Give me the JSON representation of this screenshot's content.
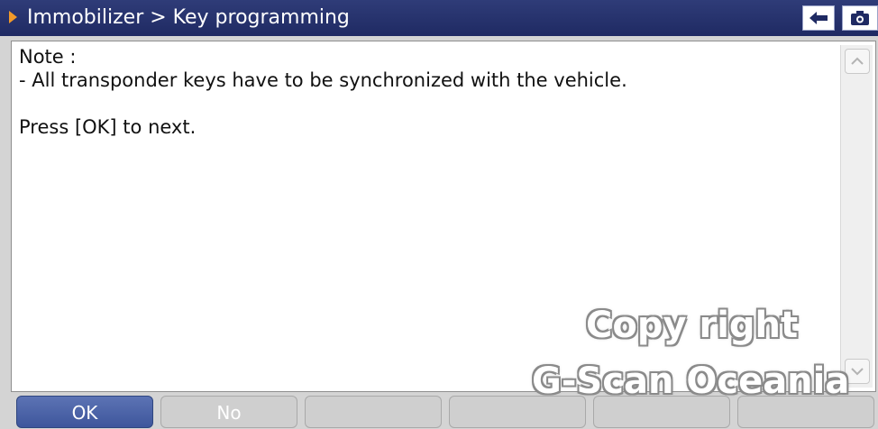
{
  "header": {
    "breadcrumb": "Immobilizer > Key programming",
    "icons": {
      "back": "left-arrow-icon",
      "capture": "camera-icon"
    }
  },
  "message": {
    "line1": "Note :",
    "line2": "- All transponder keys have to be synchronized with the vehicle.",
    "line3": "",
    "line4": "Press [OK] to next."
  },
  "watermark": {
    "line1": "Copy right",
    "line2": "G-Scan Oceania"
  },
  "buttons": [
    {
      "label": "OK",
      "state": "active"
    },
    {
      "label": "No",
      "state": "normal"
    },
    {
      "label": "",
      "state": "disabled"
    },
    {
      "label": "",
      "state": "disabled"
    },
    {
      "label": "",
      "state": "disabled"
    },
    {
      "label": "",
      "state": "disabled"
    }
  ],
  "colors": {
    "title_bg": "#1f2a63",
    "accent_arrow": "#f19a2a",
    "primary_button": "#3e569c",
    "disabled_button": "#cfcfcf"
  }
}
